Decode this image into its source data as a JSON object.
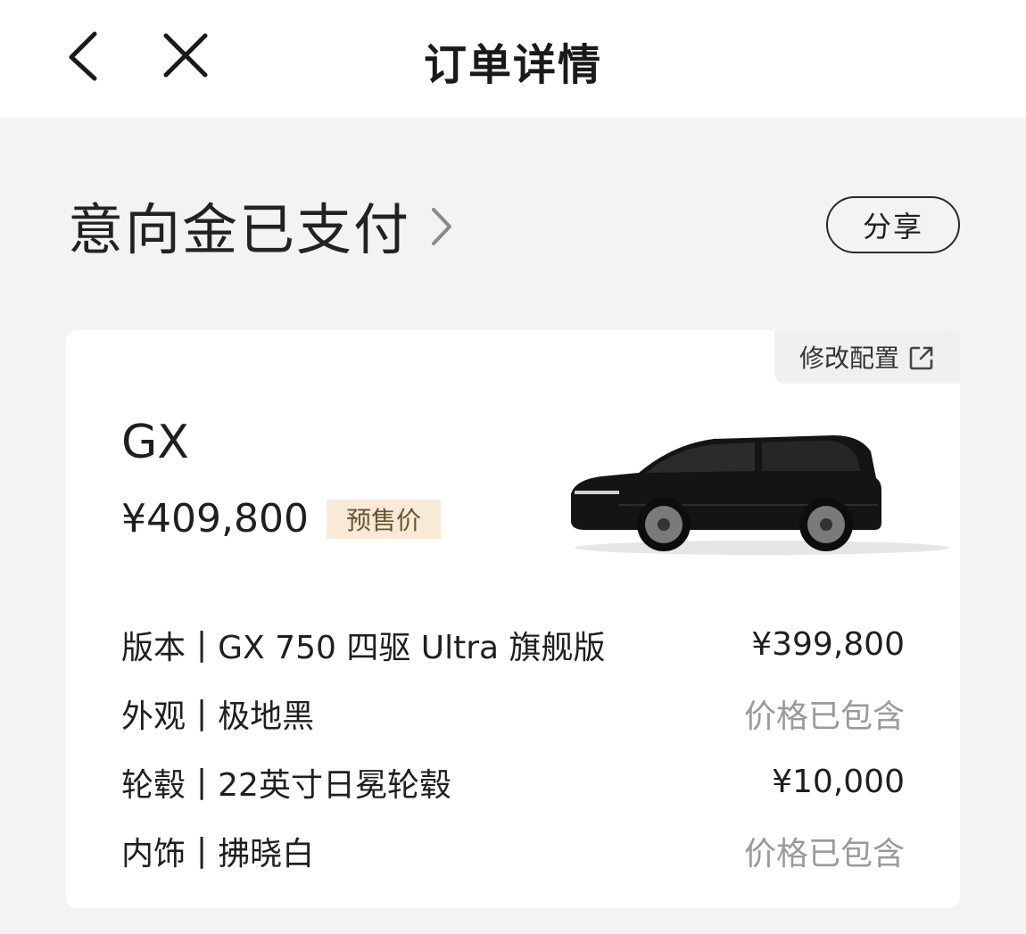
{
  "header": {
    "title": "订单详情"
  },
  "status": {
    "title": "意向金已支付",
    "share_label": "分享"
  },
  "card": {
    "modify_label": "修改配置",
    "model": "GX",
    "price": "¥409,800",
    "price_tag": "预售价",
    "specs": [
      {
        "label": "版本",
        "separator": "|",
        "value": "GX 750 四驱 Ultra 旗舰版",
        "price": "¥399,800",
        "kind": "price"
      },
      {
        "label": "外观",
        "separator": "|",
        "value": "极地黑",
        "price": "价格已包含",
        "kind": "included"
      },
      {
        "label": "轮毂",
        "separator": "|",
        "value": "22英寸日冕轮毂",
        "price": "¥10,000",
        "kind": "price"
      },
      {
        "label": "内饰",
        "separator": "|",
        "value": "拂晓白",
        "price": "价格已包含",
        "kind": "included"
      }
    ]
  },
  "icons": {
    "back": "chevron-left-icon",
    "close": "close-icon",
    "status_arrow": "chevron-right-icon",
    "external": "external-link-icon"
  },
  "colors": {
    "page_bg": "#f3f3f3",
    "card_bg": "#ffffff",
    "presale_tag_bg": "#f8ead7",
    "included_text": "#9a9a9a"
  }
}
